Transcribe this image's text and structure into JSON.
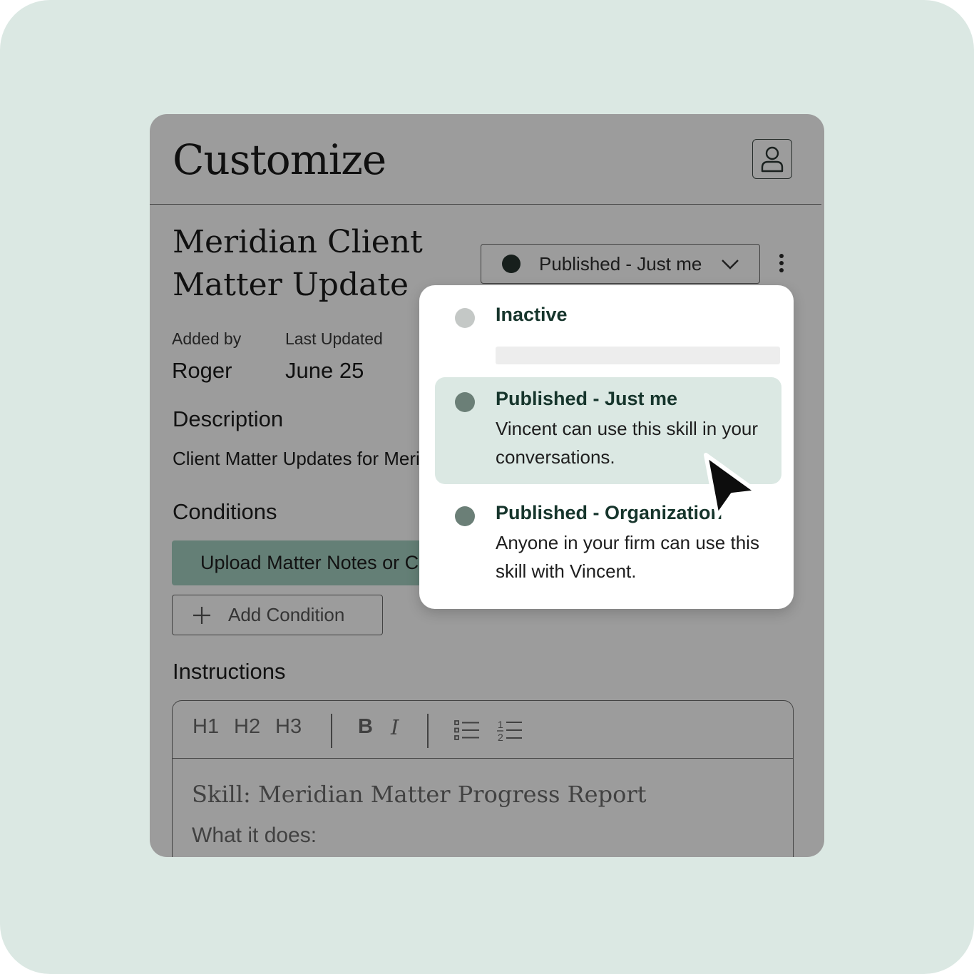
{
  "page": {
    "title": "Customize",
    "profile_icon": "user-icon"
  },
  "skill": {
    "title": "Meridian Client Matter Update",
    "status_label": "Published - Just me",
    "added_by_label": "Added by",
    "added_by_value": "Roger",
    "last_updated_label": "Last Updated",
    "last_updated_value": "June 25"
  },
  "description": {
    "heading": "Description",
    "text": "Client Matter Updates for Meridian"
  },
  "conditions": {
    "heading": "Conditions",
    "items": [
      {
        "label": "Upload Matter Notes or Case Files",
        "icon": "check-icon"
      }
    ],
    "add_label": "Add Condition"
  },
  "instructions": {
    "heading": "Instructions",
    "toolbar": {
      "h1": "H1",
      "h2": "H2",
      "h3": "H3",
      "bold": "B",
      "italic": "I",
      "bullet_list_icon": "bullet-list-icon",
      "numbered_list_icon": "numbered-list-icon"
    },
    "content_heading": "Skill: Meridian Matter Progress Report",
    "content_line": "What it does:"
  },
  "status_menu": {
    "options": [
      {
        "title": "Inactive",
        "description": "",
        "dot_color": "#c4c8c6"
      },
      {
        "title": "Published - Just me",
        "description": "Vincent can use this skill in your conversations.",
        "dot_color": "#6b7f77",
        "selected": true
      },
      {
        "title": "Published - Organization",
        "description": "Anyone in your firm can use this skill with Vincent.",
        "dot_color": "#6b7f77"
      }
    ]
  },
  "colors": {
    "background": "#dbe8e3",
    "accent_green": "#a4d0c1",
    "selected_option": "#dbe8e3",
    "title_text": "#16352c"
  }
}
